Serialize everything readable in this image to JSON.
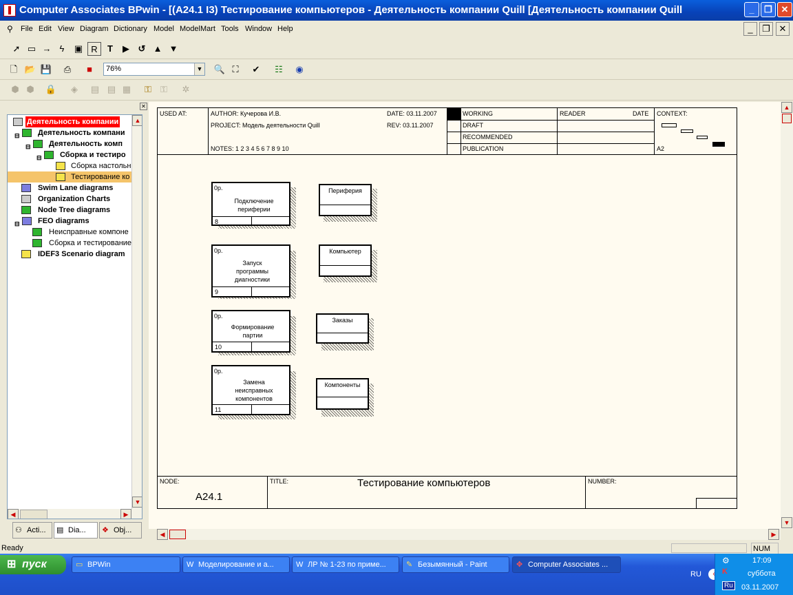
{
  "window": {
    "title": "Computer Associates BPwin - [(A24.1 I3) Тестирование компьютеров - Деятельность компании Quill  [Деятельность компании Quill"
  },
  "menu": [
    "File",
    "Edit",
    "View",
    "Diagram",
    "Dictionary",
    "Model",
    "ModelMart",
    "Tools",
    "Window",
    "Help"
  ],
  "toolbar": {
    "zoom": "76%"
  },
  "tree": {
    "root": "Деятельность компании",
    "n1": "Деятельность компани",
    "n2": "Деятельность комп",
    "n3": "Сборка и тестиро",
    "n4": "Сборка настольн",
    "n5": "Тестирование ко",
    "swim": "Swim Lane diagrams",
    "org": "Organization Charts",
    "nodetree": "Node Tree diagrams",
    "feo": "FEO diagrams",
    "feo1": "Неисправные компоне",
    "feo2": "Сборка и тестирование",
    "idef3": "IDEF3 Scenario diagram"
  },
  "tabs": [
    "Acti...",
    "Dia...",
    "Obj..."
  ],
  "frame": {
    "used_at": "USED AT:",
    "author": "AUTHOR:  Кучерова И.В.",
    "project": "PROJECT:  Модель деятельности Quill",
    "notes": "NOTES:  1  2  3  4  5  6  7  8  9  10",
    "date": "DATE: 03.11.2007",
    "rev": "REV:   03.11.2007",
    "working": "WORKING",
    "draft": "DRAFT",
    "recommended": "RECOMMENDED",
    "publication": "PUBLICATION",
    "reader": "READER",
    "date2": "DATE",
    "context": "CONTEXT:",
    "a2": "A2",
    "node_label": "NODE:",
    "node_value": "A24.1",
    "title_label": "TITLE:",
    "title_value": "Тестирование компьютеров",
    "number_label": "NUMBER:"
  },
  "activities": [
    {
      "op": "0р.",
      "name": "Подключение периферии",
      "num": "8"
    },
    {
      "op": "0р.",
      "name": "Запуск программы диагностики",
      "num": "9"
    },
    {
      "op": "0р.",
      "name": "Формирование партии",
      "num": "10"
    },
    {
      "op": "0р.",
      "name": "Замена неисправных компонентов",
      "num": "11"
    }
  ],
  "stores": [
    "Периферия",
    "Компьютер",
    "Заказы",
    "Компоненты"
  ],
  "status": {
    "ready": "Ready",
    "num": "NUM"
  },
  "taskbar": {
    "start": "пуск",
    "tasks": [
      "BPWin",
      "Моделирование и а...",
      "ЛР № 1-23 по приме...",
      "Безымянный - Paint",
      "Computer Associates ..."
    ],
    "lang": "RU",
    "time": "17:09",
    "day": "суббота",
    "date": "03.11.2007"
  }
}
